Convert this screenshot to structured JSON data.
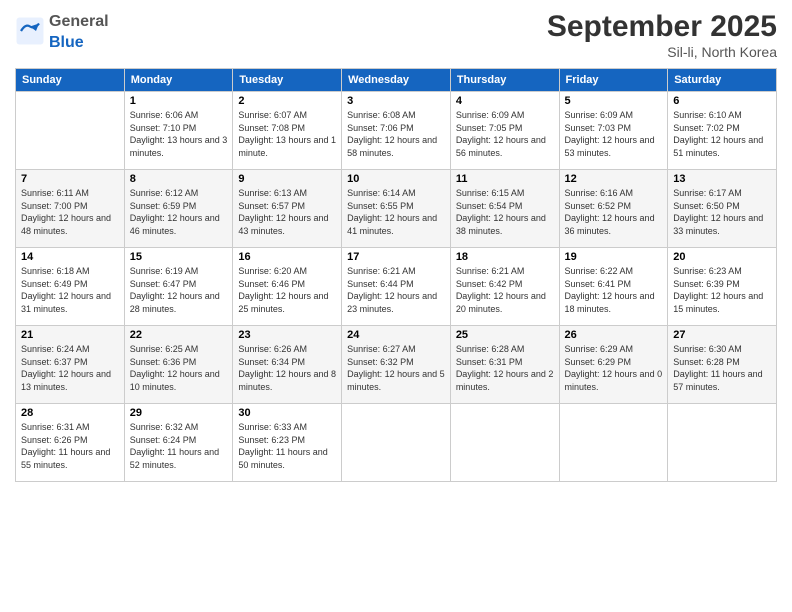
{
  "header": {
    "logo_general": "General",
    "logo_blue": "Blue",
    "month": "September 2025",
    "location": "Sil-li, North Korea"
  },
  "weekdays": [
    "Sunday",
    "Monday",
    "Tuesday",
    "Wednesday",
    "Thursday",
    "Friday",
    "Saturday"
  ],
  "weeks": [
    [
      {
        "day": "",
        "sunrise": "",
        "sunset": "",
        "daylight": ""
      },
      {
        "day": "1",
        "sunrise": "Sunrise: 6:06 AM",
        "sunset": "Sunset: 7:10 PM",
        "daylight": "Daylight: 13 hours and 3 minutes."
      },
      {
        "day": "2",
        "sunrise": "Sunrise: 6:07 AM",
        "sunset": "Sunset: 7:08 PM",
        "daylight": "Daylight: 13 hours and 1 minute."
      },
      {
        "day": "3",
        "sunrise": "Sunrise: 6:08 AM",
        "sunset": "Sunset: 7:06 PM",
        "daylight": "Daylight: 12 hours and 58 minutes."
      },
      {
        "day": "4",
        "sunrise": "Sunrise: 6:09 AM",
        "sunset": "Sunset: 7:05 PM",
        "daylight": "Daylight: 12 hours and 56 minutes."
      },
      {
        "day": "5",
        "sunrise": "Sunrise: 6:09 AM",
        "sunset": "Sunset: 7:03 PM",
        "daylight": "Daylight: 12 hours and 53 minutes."
      },
      {
        "day": "6",
        "sunrise": "Sunrise: 6:10 AM",
        "sunset": "Sunset: 7:02 PM",
        "daylight": "Daylight: 12 hours and 51 minutes."
      }
    ],
    [
      {
        "day": "7",
        "sunrise": "Sunrise: 6:11 AM",
        "sunset": "Sunset: 7:00 PM",
        "daylight": "Daylight: 12 hours and 48 minutes."
      },
      {
        "day": "8",
        "sunrise": "Sunrise: 6:12 AM",
        "sunset": "Sunset: 6:59 PM",
        "daylight": "Daylight: 12 hours and 46 minutes."
      },
      {
        "day": "9",
        "sunrise": "Sunrise: 6:13 AM",
        "sunset": "Sunset: 6:57 PM",
        "daylight": "Daylight: 12 hours and 43 minutes."
      },
      {
        "day": "10",
        "sunrise": "Sunrise: 6:14 AM",
        "sunset": "Sunset: 6:55 PM",
        "daylight": "Daylight: 12 hours and 41 minutes."
      },
      {
        "day": "11",
        "sunrise": "Sunrise: 6:15 AM",
        "sunset": "Sunset: 6:54 PM",
        "daylight": "Daylight: 12 hours and 38 minutes."
      },
      {
        "day": "12",
        "sunrise": "Sunrise: 6:16 AM",
        "sunset": "Sunset: 6:52 PM",
        "daylight": "Daylight: 12 hours and 36 minutes."
      },
      {
        "day": "13",
        "sunrise": "Sunrise: 6:17 AM",
        "sunset": "Sunset: 6:50 PM",
        "daylight": "Daylight: 12 hours and 33 minutes."
      }
    ],
    [
      {
        "day": "14",
        "sunrise": "Sunrise: 6:18 AM",
        "sunset": "Sunset: 6:49 PM",
        "daylight": "Daylight: 12 hours and 31 minutes."
      },
      {
        "day": "15",
        "sunrise": "Sunrise: 6:19 AM",
        "sunset": "Sunset: 6:47 PM",
        "daylight": "Daylight: 12 hours and 28 minutes."
      },
      {
        "day": "16",
        "sunrise": "Sunrise: 6:20 AM",
        "sunset": "Sunset: 6:46 PM",
        "daylight": "Daylight: 12 hours and 25 minutes."
      },
      {
        "day": "17",
        "sunrise": "Sunrise: 6:21 AM",
        "sunset": "Sunset: 6:44 PM",
        "daylight": "Daylight: 12 hours and 23 minutes."
      },
      {
        "day": "18",
        "sunrise": "Sunrise: 6:21 AM",
        "sunset": "Sunset: 6:42 PM",
        "daylight": "Daylight: 12 hours and 20 minutes."
      },
      {
        "day": "19",
        "sunrise": "Sunrise: 6:22 AM",
        "sunset": "Sunset: 6:41 PM",
        "daylight": "Daylight: 12 hours and 18 minutes."
      },
      {
        "day": "20",
        "sunrise": "Sunrise: 6:23 AM",
        "sunset": "Sunset: 6:39 PM",
        "daylight": "Daylight: 12 hours and 15 minutes."
      }
    ],
    [
      {
        "day": "21",
        "sunrise": "Sunrise: 6:24 AM",
        "sunset": "Sunset: 6:37 PM",
        "daylight": "Daylight: 12 hours and 13 minutes."
      },
      {
        "day": "22",
        "sunrise": "Sunrise: 6:25 AM",
        "sunset": "Sunset: 6:36 PM",
        "daylight": "Daylight: 12 hours and 10 minutes."
      },
      {
        "day": "23",
        "sunrise": "Sunrise: 6:26 AM",
        "sunset": "Sunset: 6:34 PM",
        "daylight": "Daylight: 12 hours and 8 minutes."
      },
      {
        "day": "24",
        "sunrise": "Sunrise: 6:27 AM",
        "sunset": "Sunset: 6:32 PM",
        "daylight": "Daylight: 12 hours and 5 minutes."
      },
      {
        "day": "25",
        "sunrise": "Sunrise: 6:28 AM",
        "sunset": "Sunset: 6:31 PM",
        "daylight": "Daylight: 12 hours and 2 minutes."
      },
      {
        "day": "26",
        "sunrise": "Sunrise: 6:29 AM",
        "sunset": "Sunset: 6:29 PM",
        "daylight": "Daylight: 12 hours and 0 minutes."
      },
      {
        "day": "27",
        "sunrise": "Sunrise: 6:30 AM",
        "sunset": "Sunset: 6:28 PM",
        "daylight": "Daylight: 11 hours and 57 minutes."
      }
    ],
    [
      {
        "day": "28",
        "sunrise": "Sunrise: 6:31 AM",
        "sunset": "Sunset: 6:26 PM",
        "daylight": "Daylight: 11 hours and 55 minutes."
      },
      {
        "day": "29",
        "sunrise": "Sunrise: 6:32 AM",
        "sunset": "Sunset: 6:24 PM",
        "daylight": "Daylight: 11 hours and 52 minutes."
      },
      {
        "day": "30",
        "sunrise": "Sunrise: 6:33 AM",
        "sunset": "Sunset: 6:23 PM",
        "daylight": "Daylight: 11 hours and 50 minutes."
      },
      {
        "day": "",
        "sunrise": "",
        "sunset": "",
        "daylight": ""
      },
      {
        "day": "",
        "sunrise": "",
        "sunset": "",
        "daylight": ""
      },
      {
        "day": "",
        "sunrise": "",
        "sunset": "",
        "daylight": ""
      },
      {
        "day": "",
        "sunrise": "",
        "sunset": "",
        "daylight": ""
      }
    ]
  ]
}
